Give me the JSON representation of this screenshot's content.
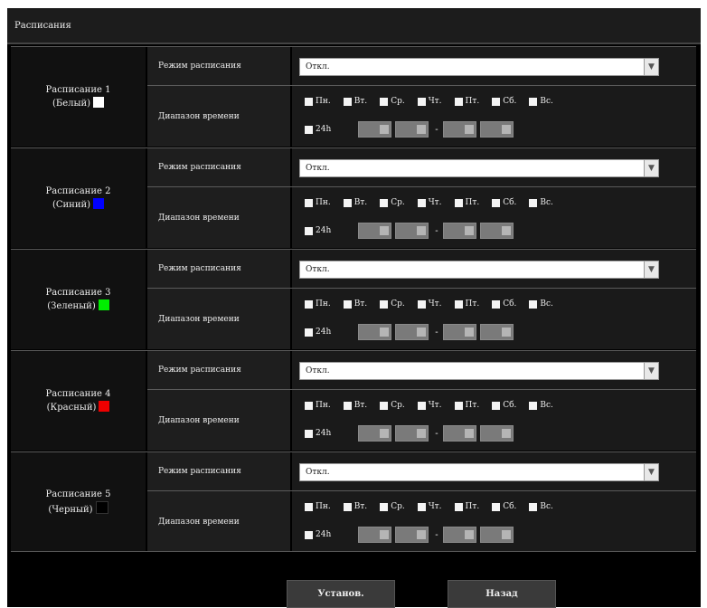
{
  "page": {
    "title": "Расписания"
  },
  "labels": {
    "mode": "Режим расписания",
    "range": "Диапазон времени",
    "h24": "24h",
    "dash": "-",
    "arrow_icon": "chevron-down-icon"
  },
  "days": [
    "Пн.",
    "Вт.",
    "Ср.",
    "Чт.",
    "Пт.",
    "Сб.",
    "Вс."
  ],
  "schedules": [
    {
      "name": "Расписание 1",
      "color_label": "(Белый)",
      "color": "#ffffff",
      "mode": "Откл."
    },
    {
      "name": "Расписание 2",
      "color_label": "(Синий)",
      "color": "#0000ff",
      "mode": "Откл."
    },
    {
      "name": "Расписание 3",
      "color_label": "(Зеленый)",
      "color": "#00ee00",
      "mode": "Откл."
    },
    {
      "name": "Расписание 4",
      "color_label": "(Красный)",
      "color": "#ee0000",
      "mode": "Откл."
    },
    {
      "name": "Расписание 5",
      "color_label": "(Черный)",
      "color": "#000000",
      "mode": "Откл."
    }
  ],
  "buttons": {
    "set": "Установ.",
    "back": "Назад"
  }
}
